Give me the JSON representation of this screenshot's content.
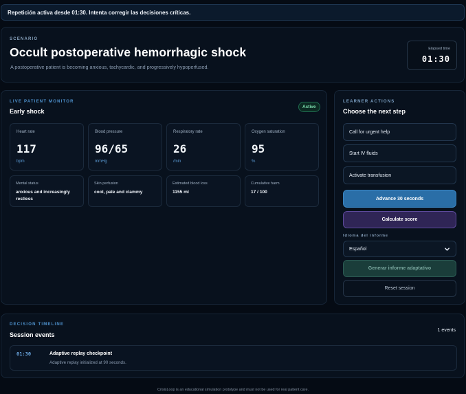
{
  "banner": "Repetición activa desde 01:30. Intenta corregir las decisiones críticas.",
  "scenario": {
    "kicker": "Scenario",
    "title": "Occult postoperative hemorrhagic shock",
    "description": "A postoperative patient is becoming anxious, tachycardic, and progressively hypoperfused.",
    "elapsed_label": "Elapsed time",
    "elapsed_value": "01:30"
  },
  "monitor": {
    "kicker": "Live patient monitor",
    "stage": "Early shock",
    "status": "Active",
    "vitals": [
      {
        "label": "Heart rate",
        "value": "117",
        "unit": "bpm"
      },
      {
        "label": "Blood pressure",
        "value": "96/65",
        "unit": "mmHg"
      },
      {
        "label": "Respiratory rate",
        "value": "26",
        "unit": "/min"
      },
      {
        "label": "Oxygen saturation",
        "value": "95",
        "unit": "%"
      }
    ],
    "stats": [
      {
        "label": "Mental status",
        "value": "anxious and increasingly restless"
      },
      {
        "label": "Skin perfusion",
        "value": "cool, pale and clammy"
      },
      {
        "label": "Estimated blood loss",
        "value": "1155 ml"
      },
      {
        "label": "Cumulative harm",
        "value": "17 / 100"
      }
    ]
  },
  "actions": {
    "kicker": "Learner actions",
    "title": "Choose the next step",
    "options": [
      "Call for urgent help",
      "Start IV fluids",
      "Activate transfusion"
    ],
    "advance": "Advance 30 seconds",
    "score": "Calculate score",
    "language_label": "Idioma del informe",
    "language_value": "Español",
    "report": "Generar informe adaptativo",
    "reset": "Reset session"
  },
  "timeline": {
    "kicker": "Decision timeline",
    "title": "Session events",
    "count": "1 events",
    "events": [
      {
        "time": "01:30",
        "title": "Adaptive replay checkpoint",
        "detail": "Adaptive replay initialized at 90 seconds."
      }
    ]
  },
  "footer": "CrisisLoop is an educational simulation prototype and must not be used for real patient care.",
  "colors": {
    "background": "#050b14",
    "primary": "#2a6ea7",
    "score": "#2f2556",
    "report": "#1a3d3a",
    "active": "#7ee0b0"
  }
}
